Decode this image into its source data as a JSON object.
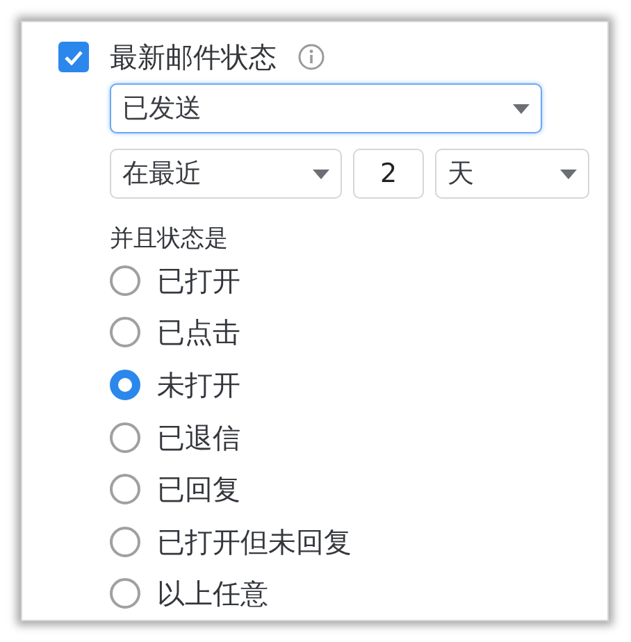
{
  "filter": {
    "checked": true,
    "title": "最新邮件状态"
  },
  "status_select": {
    "value": "已发送",
    "focused": true
  },
  "range_select": {
    "value": "在最近"
  },
  "count_field": {
    "value": "2"
  },
  "unit_select": {
    "value": "天"
  },
  "radio_label": "并且状态是",
  "options": [
    {
      "label": "已打开",
      "selected": false
    },
    {
      "label": "已点击",
      "selected": false
    },
    {
      "label": "未打开",
      "selected": true
    },
    {
      "label": "已退信",
      "selected": false
    },
    {
      "label": "已回复",
      "selected": false
    },
    {
      "label": "已打开但未回复",
      "selected": false
    },
    {
      "label": "以上任意",
      "selected": false
    }
  ]
}
